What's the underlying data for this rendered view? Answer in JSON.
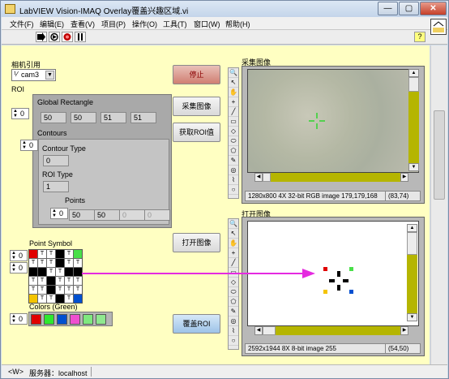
{
  "window": {
    "title": "LabVIEW Vision-IMAQ Overlay覆盖兴趣区域.vi",
    "minimize_glyph": "—",
    "maximize_glyph": "▢",
    "close_glyph": "✕"
  },
  "menu": [
    "文件(F)",
    "编辑(E)",
    "查看(V)",
    "项目(P)",
    "操作(O)",
    "工具(T)",
    "窗口(W)",
    "帮助(H)"
  ],
  "toolbar": {
    "run_icon": "run-arrow-icon",
    "run_continuous_icon": "run-continuously-icon",
    "abort_icon": "abort-icon",
    "pause_icon": "pause-icon",
    "help_glyph": "?"
  },
  "camera": {
    "label": "相机引用",
    "value": "cam3"
  },
  "roi": {
    "label": "ROI",
    "index_outer": "0",
    "global_rect_label": "Global Rectangle",
    "global_rect": [
      "50",
      "50",
      "51",
      "51"
    ],
    "contours_label": "Contours",
    "contours_index": "0",
    "contour_type_label": "Contour Type",
    "contour_type": "0",
    "roi_type_label": "ROI Type",
    "roi_type": "1",
    "points_label": "Points",
    "points_index": "0",
    "points": [
      "50",
      "50",
      "0",
      "0"
    ]
  },
  "buttons": {
    "stop": "停止",
    "capture": "采集图像",
    "get_roi": "获取ROI值",
    "open": "打开图像",
    "overlay": "覆盖ROI"
  },
  "capture_display": {
    "label": "采集图像",
    "status": "1280x800 4X 32-bit RGB image 179,179,168",
    "coords": "(83,74)"
  },
  "open_display": {
    "label": "打开图像",
    "status": "2592x1944 8X 8-bit image 255",
    "coords": "(54,50)"
  },
  "point_symbol": {
    "label": "Point Symbol",
    "index_a": "0",
    "index_b": "0",
    "cell_char": "T"
  },
  "colors": {
    "label": "Colors (Green)",
    "index": "0",
    "swatches": [
      "#e00000",
      "#2ee82e",
      "#0050d0",
      "#ef4fd0",
      "#7fe87f",
      "#8fe88f"
    ]
  },
  "status_bar": {
    "target": "<W>",
    "server": "服务器：localhost"
  },
  "accent_colors": {
    "panel_bg": "#ffffc2",
    "scroll_olive": "#b5b500",
    "arrow_magenta": "#e52ae0"
  }
}
